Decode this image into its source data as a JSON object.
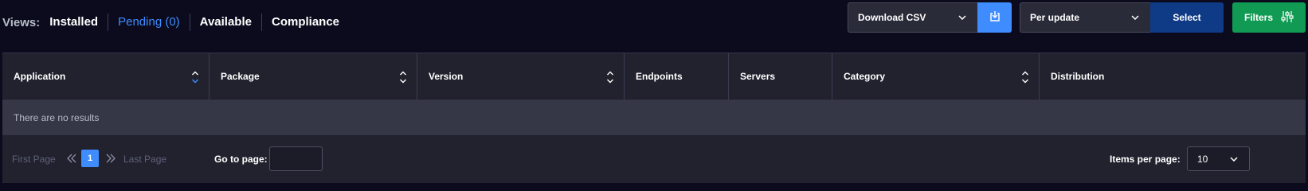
{
  "views": {
    "label": "Views:",
    "items": [
      {
        "label": "Installed",
        "active": false
      },
      {
        "label": "Pending (0)",
        "active": true
      },
      {
        "label": "Available",
        "active": false
      },
      {
        "label": "Compliance",
        "active": false
      }
    ]
  },
  "toolbar": {
    "download_select": "Download CSV",
    "per_select": "Per update",
    "select_label": "Select",
    "filters_label": "Filters"
  },
  "table": {
    "columns": [
      {
        "label": "Application",
        "sortable": true,
        "sorted": "asc"
      },
      {
        "label": "Package",
        "sortable": true
      },
      {
        "label": "Version",
        "sortable": true
      },
      {
        "label": "Endpoints",
        "sortable": false
      },
      {
        "label": "Servers",
        "sortable": false
      },
      {
        "label": "Category",
        "sortable": true
      },
      {
        "label": "Distribution",
        "sortable": false
      }
    ],
    "empty_message": "There are no results"
  },
  "pager": {
    "first_page": "First Page",
    "current_page": "1",
    "last_page": "Last Page",
    "goto_label": "Go to page:",
    "goto_value": "",
    "items_per_page_label": "Items per page:",
    "items_per_page_value": "10"
  },
  "colors": {
    "accent": "#3f8cff",
    "select_button": "#0f3a86",
    "filters_button": "#119a54",
    "background": "#0b0b1d"
  }
}
